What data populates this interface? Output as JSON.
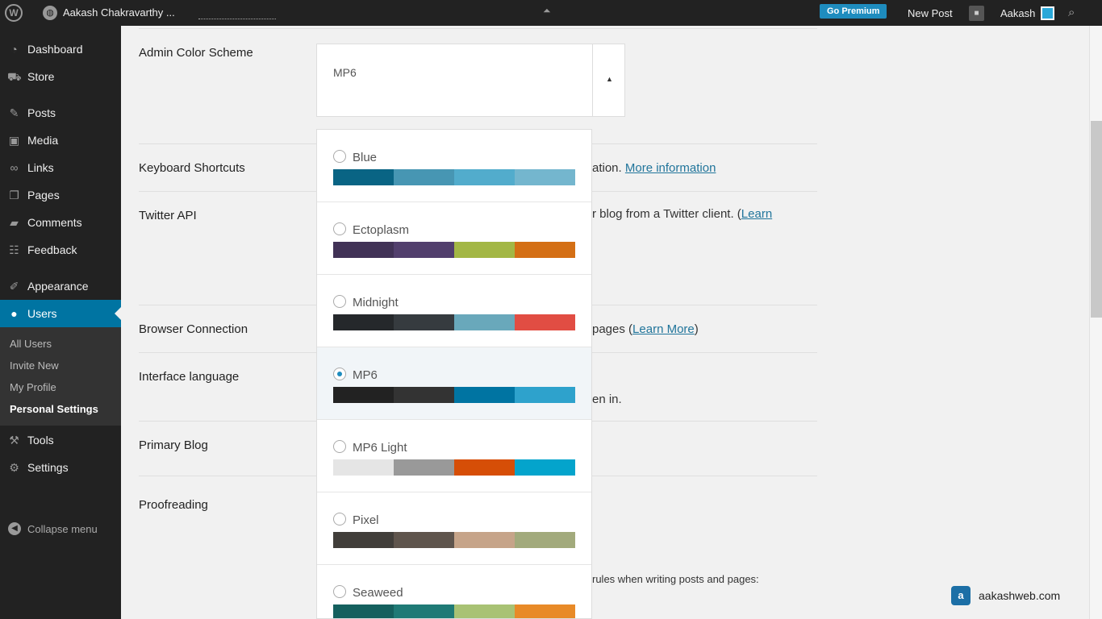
{
  "topbar": {
    "site_name": "Aakash Chakravarthy ...",
    "go_premium": "Go Premium",
    "new_post": "New Post",
    "user_name": "Aakash"
  },
  "sidebar": {
    "items": [
      {
        "label": "Dashboard",
        "icon": "dashboard-icon"
      },
      {
        "label": "Store",
        "icon": "cart-icon"
      },
      {
        "label": "Posts",
        "icon": "pin-icon"
      },
      {
        "label": "Media",
        "icon": "media-icon"
      },
      {
        "label": "Links",
        "icon": "link-icon"
      },
      {
        "label": "Pages",
        "icon": "pages-icon"
      },
      {
        "label": "Comments",
        "icon": "comment-icon"
      },
      {
        "label": "Feedback",
        "icon": "feedback-icon"
      },
      {
        "label": "Appearance",
        "icon": "brush-icon"
      },
      {
        "label": "Users",
        "icon": "user-icon"
      },
      {
        "label": "Tools",
        "icon": "wrench-icon"
      },
      {
        "label": "Settings",
        "icon": "settings-icon"
      }
    ],
    "submenu": [
      "All Users",
      "Invite New",
      "My Profile",
      "Personal Settings"
    ],
    "collapse": "Collapse menu"
  },
  "main": {
    "rows": [
      "Admin Color Scheme",
      "Keyboard Shortcuts",
      "Twitter API",
      "Browser Connection",
      "Interface language",
      "Primary Blog",
      "Proofreading"
    ],
    "keyboard_text": "ation.",
    "keyboard_link": "More information",
    "twitter_text": "r blog from a Twitter client. (",
    "twitter_link": "Learn",
    "browser_text": "pages (",
    "browser_link": "Learn More",
    "browser_close": ")",
    "interface_text": "en in.",
    "proofreading_text": "rules when writing posts and pages:"
  },
  "select": {
    "current": "MP6",
    "current_colors": [
      "#222222",
      "#333333",
      "#0074a2",
      "#2ea2cc"
    ]
  },
  "schemes": [
    {
      "name": "Blue",
      "colors": [
        "#096484",
        "#4796b3",
        "#52accc",
        "#74b6ce"
      ],
      "selected": false
    },
    {
      "name": "Ectoplasm",
      "colors": [
        "#413256",
        "#523f6d",
        "#a3b745",
        "#d46f15"
      ],
      "selected": false
    },
    {
      "name": "Midnight",
      "colors": [
        "#25282b",
        "#363b3f",
        "#69a8bb",
        "#e14d43"
      ],
      "selected": false
    },
    {
      "name": "MP6",
      "colors": [
        "#222222",
        "#333333",
        "#0074a2",
        "#2ea2cc"
      ],
      "selected": true
    },
    {
      "name": "MP6 Light",
      "colors": [
        "#e5e5e5",
        "#999999",
        "#d64e07",
        "#04a4cc"
      ],
      "selected": false
    },
    {
      "name": "Pixel",
      "colors": [
        "#413e3a",
        "#5f554d",
        "#c6a489",
        "#a2aa7c"
      ],
      "selected": false
    },
    {
      "name": "Seaweed",
      "colors": [
        "#15605e",
        "#1f7a76",
        "#a8c274",
        "#e88a27"
      ],
      "selected": false
    }
  ],
  "watermark": "aakashweb.com"
}
